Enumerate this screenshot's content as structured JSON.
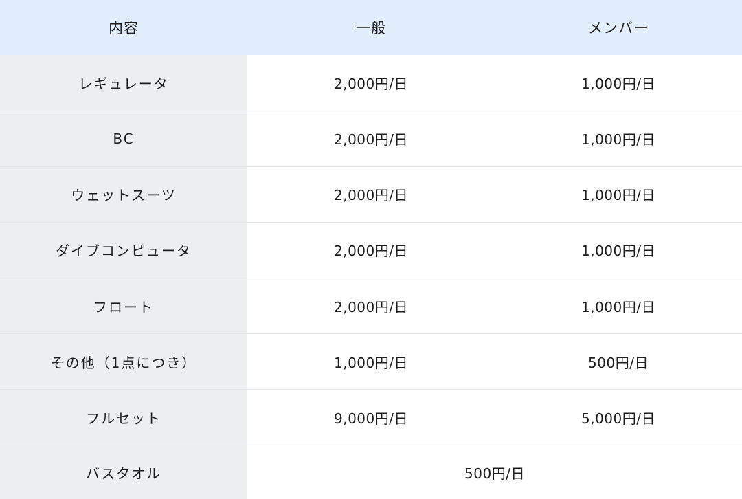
{
  "table": {
    "headers": [
      "内容",
      "一般",
      "メンバー"
    ],
    "rows": [
      {
        "item": "レギュレータ",
        "general": "2,000円/日",
        "member": "1,000円/日"
      },
      {
        "item": "BC",
        "general": "2,000円/日",
        "member": "1,000円/日"
      },
      {
        "item": "ウェットスーツ",
        "general": "2,000円/日",
        "member": "1,000円/日"
      },
      {
        "item": "ダイブコンピュータ",
        "general": "2,000円/日",
        "member": "1,000円/日"
      },
      {
        "item": "フロート",
        "general": "2,000円/日",
        "member": "1,000円/日"
      },
      {
        "item": "その他（1点につき）",
        "general": "1,000円/日",
        "member": "500円/日"
      },
      {
        "item": "フルセット",
        "general": "9,000円/日",
        "member": "5,000円/日"
      },
      {
        "item": "バスタオル",
        "general": "500円/日",
        "member": "500円/日"
      }
    ]
  },
  "colors": {
    "header_bg": "#e3eefc",
    "item_col_bg": "#edeef0",
    "row_divider": "#e6e6e6"
  }
}
